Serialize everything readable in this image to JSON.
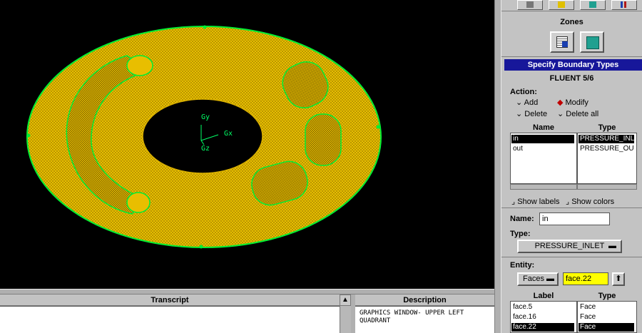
{
  "graphics": {
    "axes": {
      "y": "Gy",
      "x": "Gx",
      "z": "Gz"
    }
  },
  "toolbar": {
    "buttons": [
      "grid-icon",
      "cube-icon",
      "mesh-cube-icon",
      "tools-icon"
    ]
  },
  "zones": {
    "title": "Zones"
  },
  "boundary": {
    "title": "Specify Boundary Types",
    "app_name": "FLUENT 5/6",
    "action_label": "Action:",
    "actions": {
      "add": "Add",
      "modify": "Modify",
      "delete": "Delete",
      "delete_all": "Delete all"
    },
    "selected_action": "Modify",
    "table": {
      "headers": {
        "name": "Name",
        "type": "Type"
      },
      "rows": [
        {
          "name": "in",
          "type": "PRESSURE_INLET"
        },
        {
          "name": "out",
          "type": "PRESSURE_OUTLET"
        }
      ]
    },
    "show_labels": "Show labels",
    "show_colors": "Show colors",
    "name_label": "Name:",
    "name_value": "in",
    "type_label": "Type:",
    "type_value": "PRESSURE_INLET",
    "entity_label": "Entity:",
    "entity_type": "Faces",
    "entity_value": "face.22",
    "entity_table": {
      "headers": {
        "label": "Label",
        "type": "Type"
      },
      "rows": [
        {
          "label": "face.5",
          "type": "Face"
        },
        {
          "label": "face.16",
          "type": "Face"
        },
        {
          "label": "face.22",
          "type": "Face"
        }
      ]
    }
  },
  "transcript": {
    "title": "Transcript"
  },
  "description": {
    "title": "Description",
    "text_line1": "GRAPHICS WINDOW- UPPER LEFT",
    "text_line2": "QUADRANT"
  },
  "colors": {
    "mesh": "#f2c900",
    "edge": "#00ee33",
    "title_bar": "#17179a"
  }
}
